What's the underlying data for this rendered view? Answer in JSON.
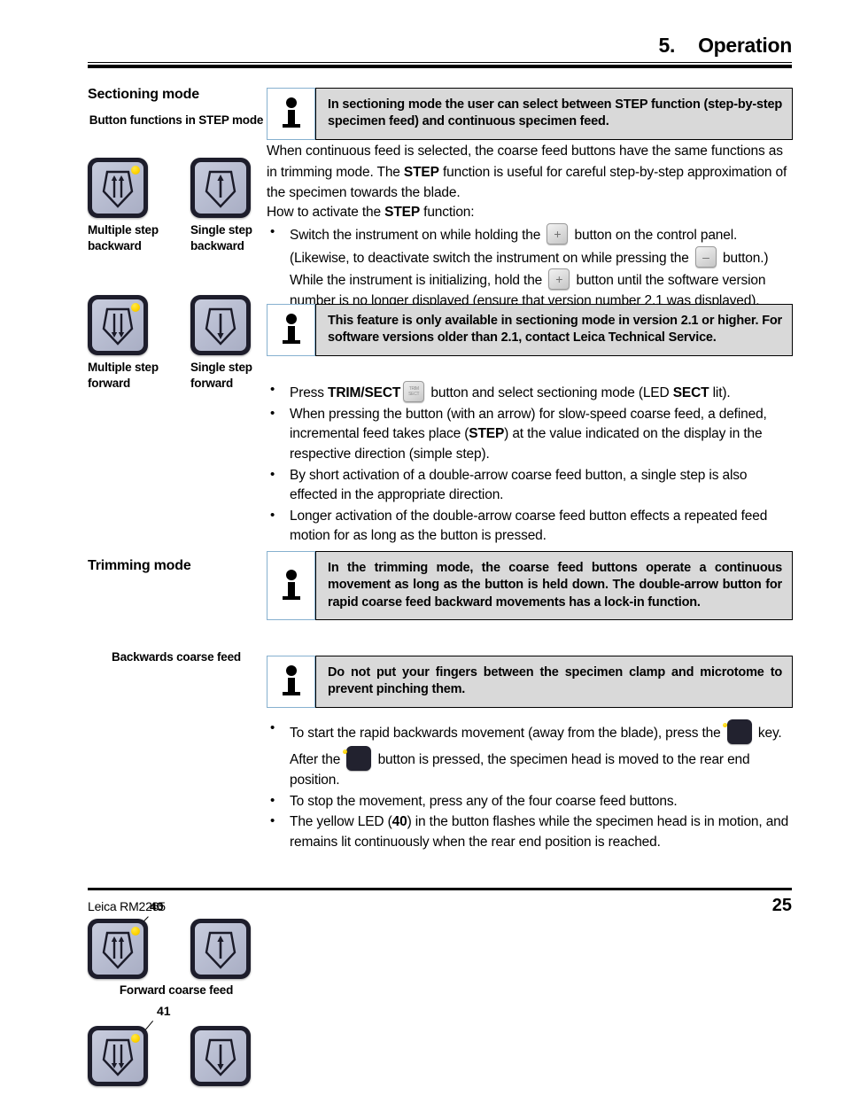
{
  "header": {
    "chapter_number": "5.",
    "title": "Operation"
  },
  "footer": {
    "model": "Leica RM2265",
    "page": "25"
  },
  "left": {
    "sectioning_heading": "Sectioning mode",
    "step_buttons_caption": "Button functions in STEP mode",
    "labels": {
      "multiple_step_backward": "Multiple step backward",
      "single_step_backward": "Single step backward",
      "multiple_step_forward": "Multiple step forward",
      "single_step_forward": "Single step forward"
    },
    "trimming_heading": "Trimming mode",
    "backwards_caption": "Backwards coarse feed",
    "forward_caption": "Forward coarse feed",
    "callout_40": "40",
    "callout_41": "41"
  },
  "notes": {
    "sectioning": "In sectioning mode the user can select between STEP function (step-by-step specimen feed) and continuous specimen feed.",
    "version": "This feature is only available in sectioning mode in version 2.1 or higher. For software versions older than 2.1, contact Leica Technical Service.",
    "trimming": "In the trimming mode, the coarse feed buttons operate a continuous movement as long as the button is held down. The double-arrow button for rapid coarse feed backward movements has a lock-in function.",
    "warning": "Do not put your fingers between the specimen clamp and microtome to prevent pinching them."
  },
  "body": {
    "p1_a": "When continuous feed is selected, the coarse feed buttons have the same functions as in trimming mode. The ",
    "p1_b": "STEP",
    "p1_c": " function is useful for careful step-by-step approximation of the specimen towards the blade.",
    "p2_a": "How to activate the ",
    "p2_b": "STEP",
    "p2_c": " function:",
    "b1_t1": "Switch the instrument on while holding the ",
    "b1_t2": " button on the control panel. (Likewise, to deactivate switch the instrument on while pressing the ",
    "b1_t3": " button.) While the instrument is initializing, hold the ",
    "b1_t4": " button until the software version number is no longer displayed (ensure that version number 2.1 was displayed).",
    "b2_t1": "Press ",
    "b2_t2": "TRIM/SECT",
    "b2_t3": " button and select sectioning mode (LED ",
    "b2_t4": "SECT",
    "b2_t5": " lit).",
    "b3_t1": "When pressing the button (with an arrow) for slow-speed coarse feed, a defined, incremental feed takes place (",
    "b3_t2": "STEP",
    "b3_t3": ") at the value indicated on the display in the respective direction (simple step).",
    "b4": "By short activation of a double-arrow coarse feed button, a single step is also effected in the appropriate direction.",
    "b5": "Longer activation of the double-arrow coarse feed button effects a repeated feed motion for as long as the button is pressed.",
    "b6_t1": "To start the rapid backwards movement (away from the blade), press the ",
    "b6_t2": " key.",
    "b6_c1": "After the ",
    "b6_c2": " button is pressed, the specimen head is moved to the rear end position.",
    "b7": "To stop the movement, press any of the four coarse feed buttons.",
    "b8_t1": "The yellow LED (",
    "b8_t2": "40",
    "b8_t3": ") in the button flashes while the specimen head is in motion, and remains lit continuously when the rear end position is reached."
  },
  "icons": {
    "plus": "+",
    "minus": "–",
    "trim_line1": "TRIM",
    "trim_line2": "SECT"
  },
  "colors": {
    "note_fill": "#d9d9d9",
    "note_icon_border": "#86b0cf",
    "led_yellow": "#ffd400",
    "button_bezel": "#1d1d2b"
  }
}
